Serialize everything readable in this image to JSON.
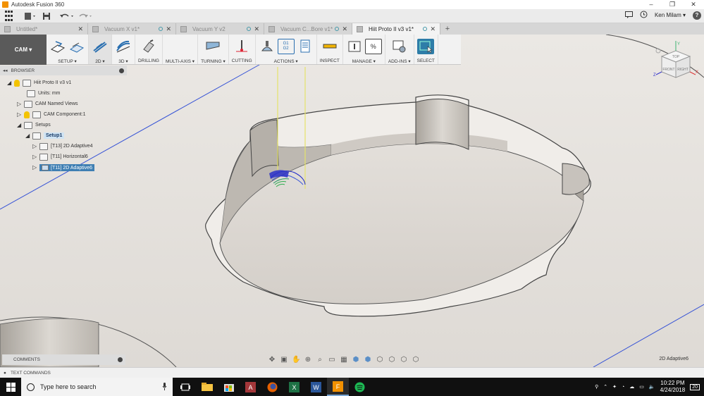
{
  "window": {
    "title": "Autodesk Fusion 360",
    "controls": [
      "–",
      "❐",
      "✕"
    ]
  },
  "quickbar": {
    "user": "Ken Milam ▾",
    "help": "?"
  },
  "tabs": [
    {
      "label": "Untitled*",
      "active": false
    },
    {
      "label": "Vacuum X v1*",
      "active": false
    },
    {
      "label": "Vacuum Y v2",
      "active": false
    },
    {
      "label": "Vacuum C...Bore v1*",
      "active": false
    },
    {
      "label": "Hiit Proto II v3 v1*",
      "active": true
    }
  ],
  "toolbar": {
    "workspace": "CAM ▾",
    "groups": [
      {
        "label": "SETUP ▾"
      },
      {
        "label": "2D ▾"
      },
      {
        "label": "3D ▾"
      },
      {
        "label": "DRILLING"
      },
      {
        "label": "MULTI-AXIS ▾"
      },
      {
        "label": "TURNING ▾"
      },
      {
        "label": "CUTTING"
      },
      {
        "label": "ACTIONS ▾"
      },
      {
        "label": "INSPECT"
      },
      {
        "label": "MANAGE ▾"
      },
      {
        "label": "ADD-INS ▾"
      },
      {
        "label": "SELECT"
      }
    ],
    "g1g2": "G1\nG2",
    "manage_percent": "%"
  },
  "browser": {
    "title": "BROWSER",
    "nodes": [
      {
        "label": "Hiit Proto II v3 v1"
      },
      {
        "label": "Units: mm"
      },
      {
        "label": "CAM Named Views"
      },
      {
        "label": "CAM Component:1"
      },
      {
        "label": "Setups"
      },
      {
        "label": "Setup1"
      },
      {
        "label": "[T13] 2D Adaptive4"
      },
      {
        "label": "[T11] Horizontal6"
      },
      {
        "label": "[T11] 2D Adaptive6"
      }
    ]
  },
  "viewcube": {
    "top": "TOP",
    "front": "FRONT",
    "right": "RIGHT",
    "x": "X",
    "y": "Y",
    "z": "Z"
  },
  "comments": {
    "label": "COMMENTS"
  },
  "status": {
    "operation": "2D Adaptive6"
  },
  "textcommands": {
    "label": "TEXT COMMANDS"
  },
  "taskbar": {
    "search_placeholder": "Type here to search",
    "time": "10:22 PM",
    "date": "4/24/2018",
    "notifications": "20"
  }
}
